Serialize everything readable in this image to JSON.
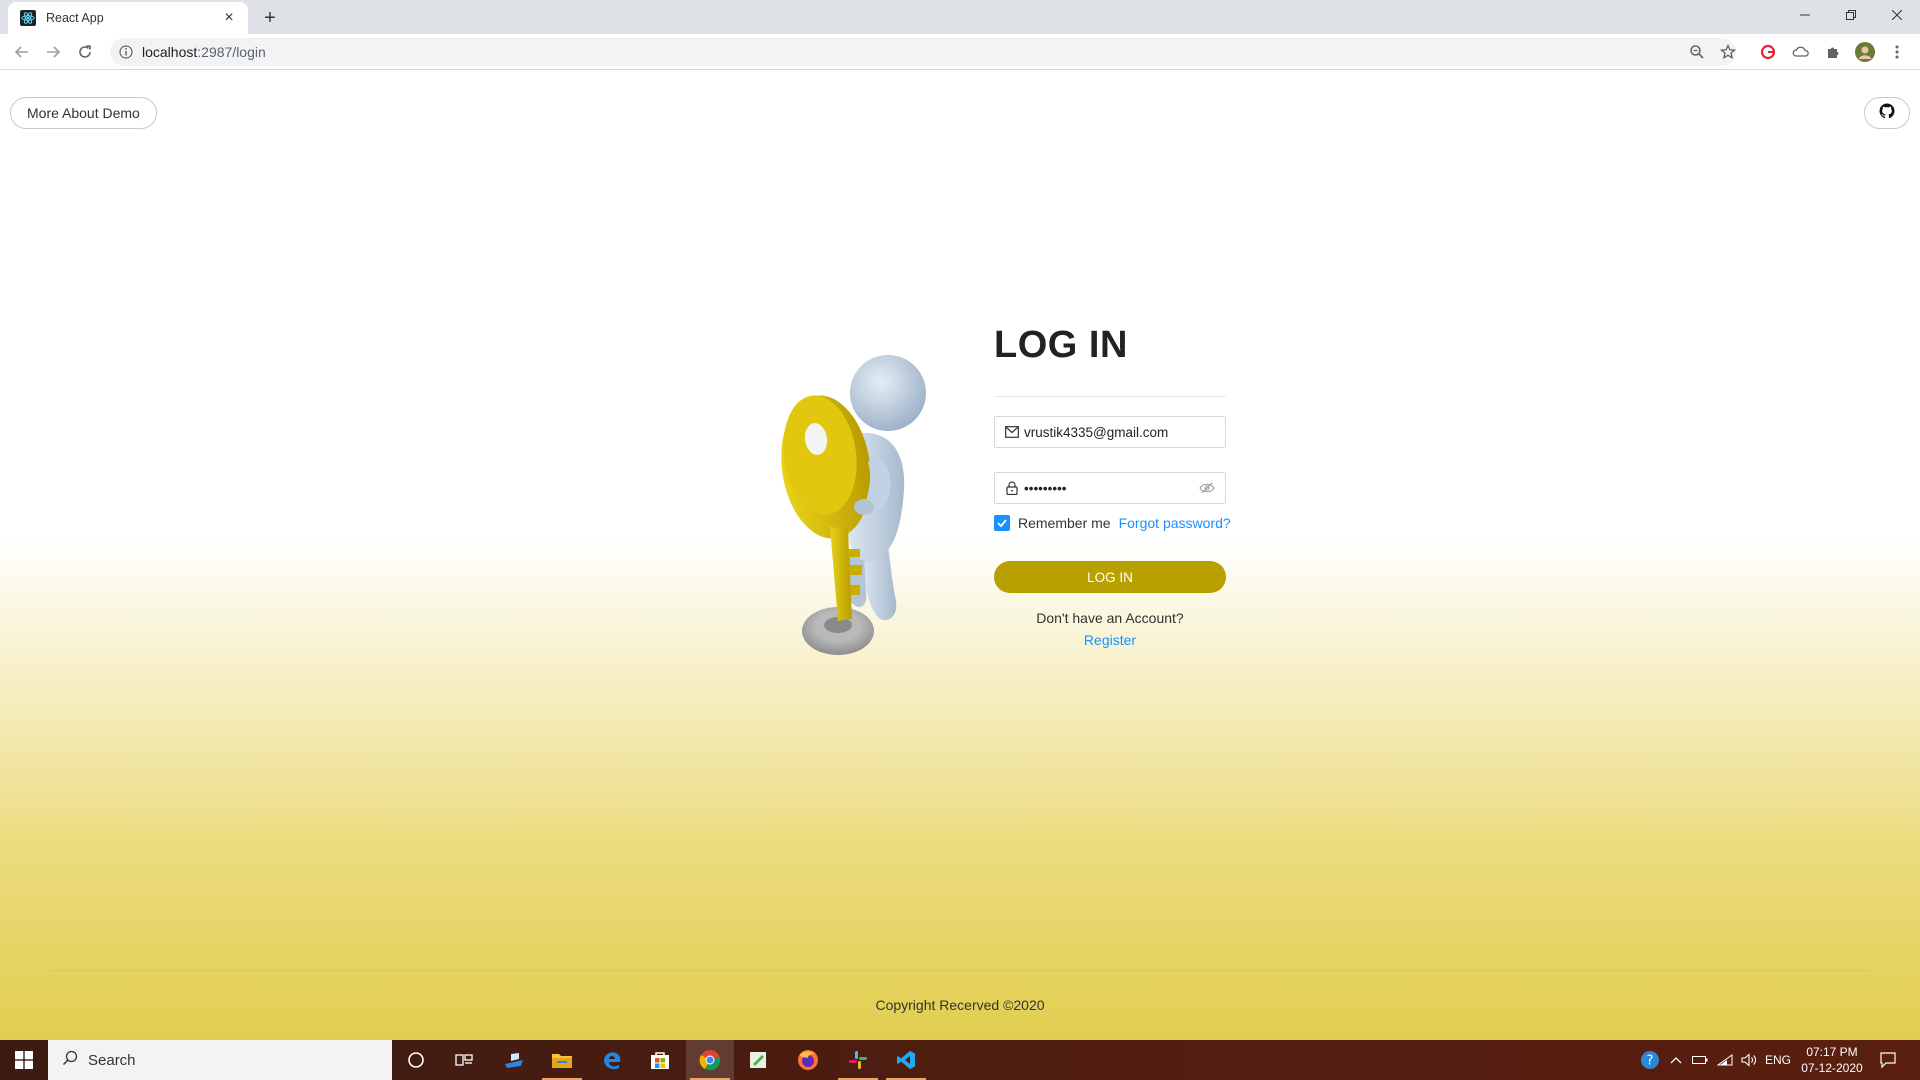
{
  "browser": {
    "tab_title": "React App",
    "url_host": "localhost",
    "url_path": ":2987/login",
    "new_tab_symbol": "+",
    "close_symbol": "×"
  },
  "page": {
    "more_button": "More About Demo",
    "github_icon": "github-icon",
    "title": "LOG IN",
    "email_value": "vrustik4335@gmail.com",
    "password_value": "•••••••••",
    "remember_label": "Remember me",
    "forgot_label": "Forgot password?",
    "remember_checked": true,
    "login_button": "LOG IN",
    "no_account_text": "Don't have an Account?",
    "register_link": "Register",
    "copyright": "Copyright Recerved ©2020"
  },
  "colors": {
    "accent": "#b8a000",
    "link": "#1890ff",
    "checkbox": "#1890ff",
    "gradient_bottom": "#e1ce4f"
  },
  "taskbar": {
    "search_placeholder": "Search",
    "language": "ENG",
    "time": "07:17 PM",
    "date": "07-12-2020"
  }
}
